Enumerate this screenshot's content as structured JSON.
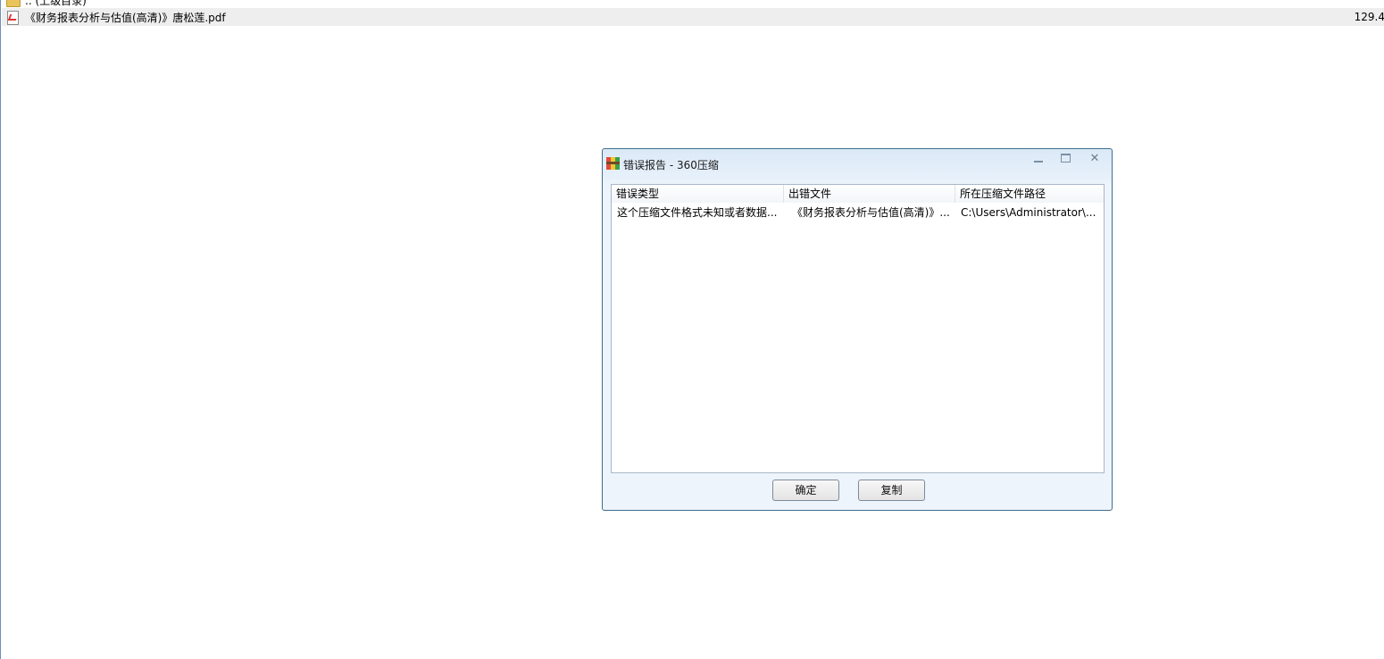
{
  "file_list": {
    "parent_row": {
      "name": ".. (上级目录)",
      "icon": "folder-up-icon"
    },
    "selected_row": {
      "name": "《财务报表分析与估值(高清)》唐松莲.pdf",
      "size": "129.4",
      "icon": "pdf-file-icon"
    }
  },
  "dialog": {
    "title": "错误报告 - 360压缩",
    "icon": "360zip-app-icon",
    "columns": [
      "错误类型",
      "出错文件",
      "所在压缩文件路径"
    ],
    "rows": [
      {
        "error_type": "这个压缩文件格式未知或者数据...",
        "error_file": "《财务报表分析与估值(高清)》...",
        "archive_path": "C:\\Users\\Administrator\\..."
      }
    ],
    "ok_button": "确定",
    "copy_button": "复制"
  },
  "colors": {
    "dialog_border": "#3f6d8f",
    "selected_row_bg": "#eeeeee",
    "titlebar_top": "#dbe9f7"
  }
}
